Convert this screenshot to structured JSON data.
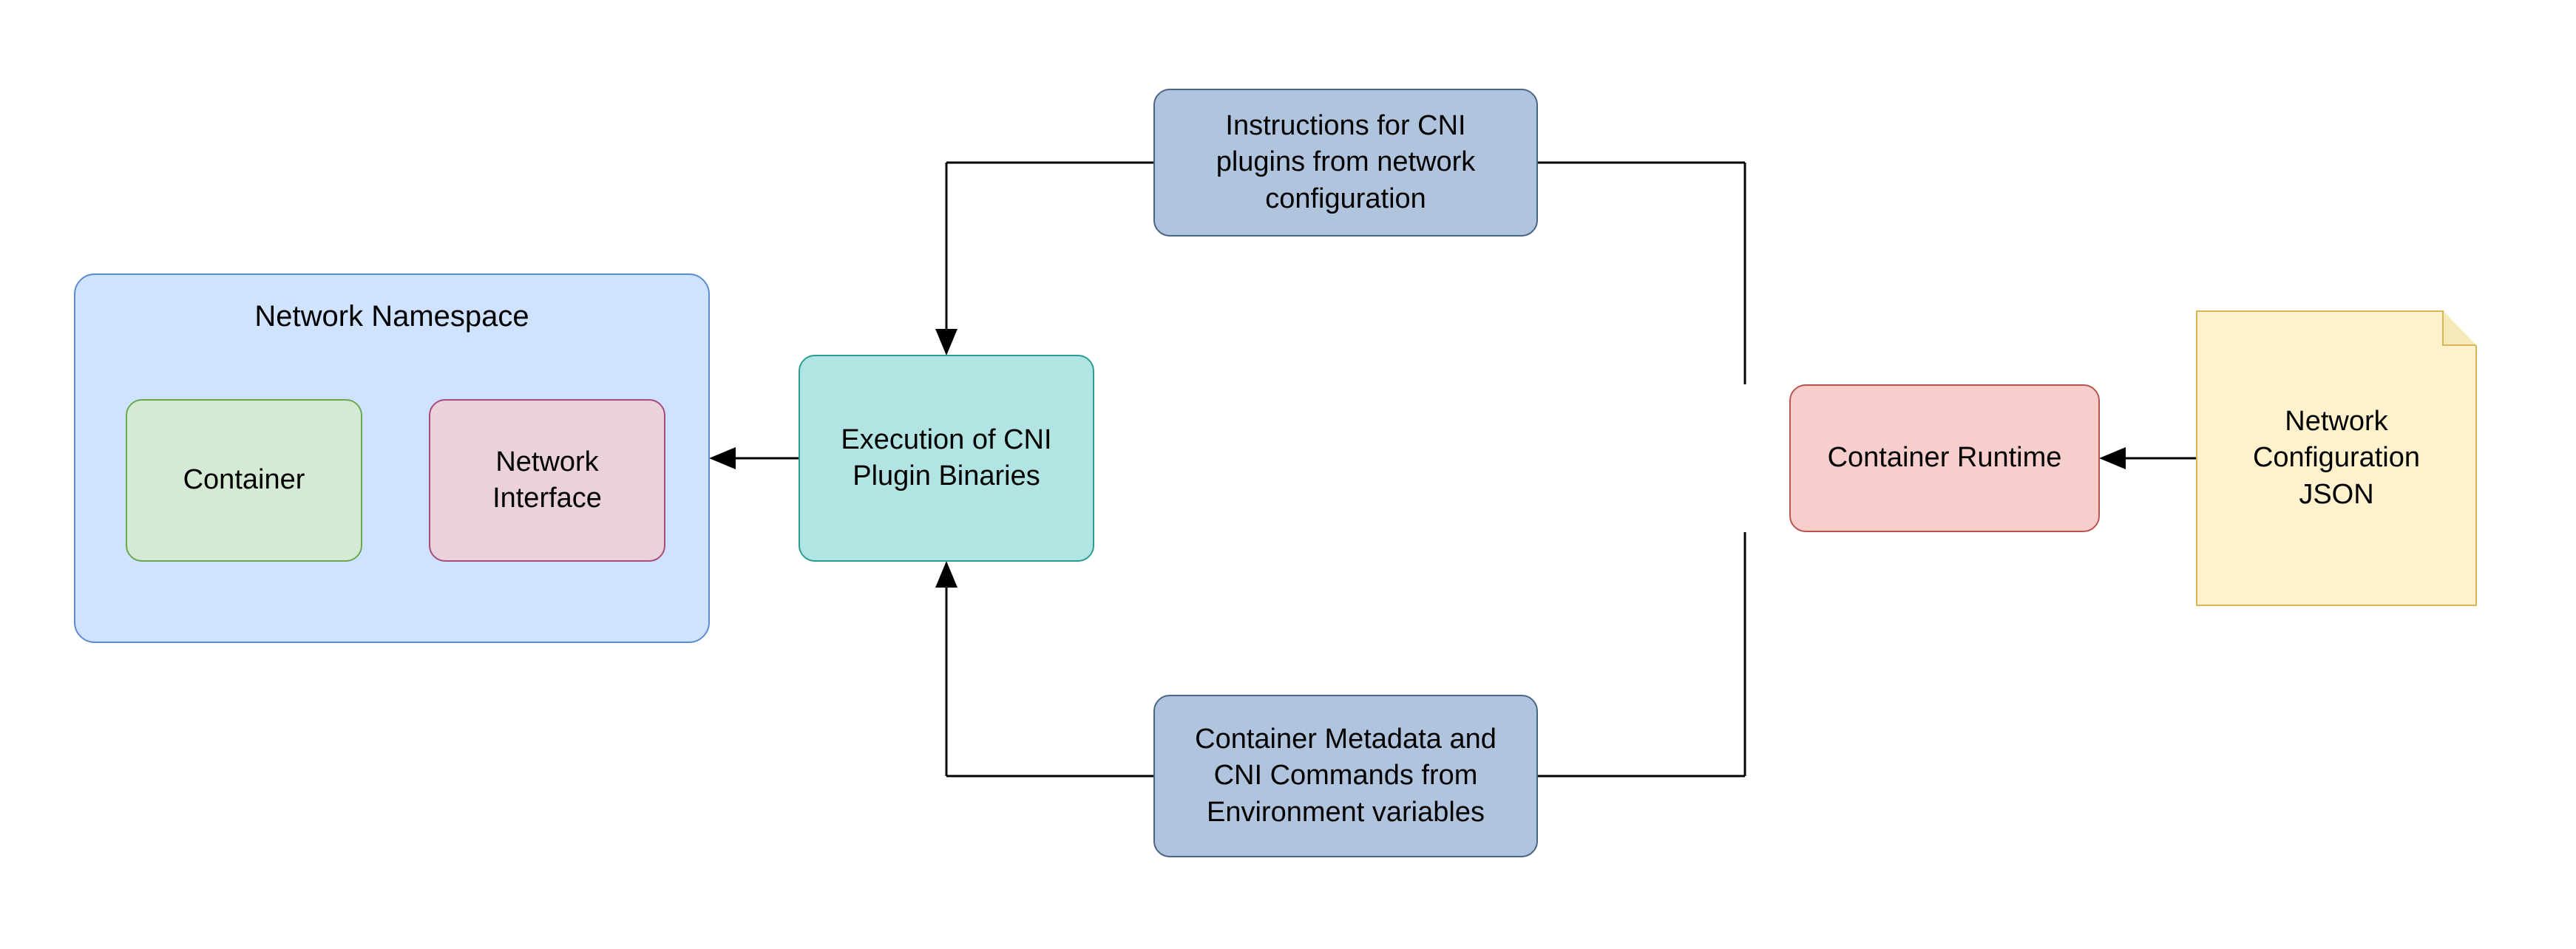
{
  "diagram": {
    "namespace": {
      "title": "Network Namespace",
      "container": "Container",
      "interface": "Network\nInterface"
    },
    "execution": "Execution of CNI\nPlugin Binaries",
    "instructions": "Instructions for CNI\nplugins from network\nconfiguration",
    "metadata": "Container Metadata and\nCNI Commands from\nEnvironment variables",
    "runtime": "Container Runtime",
    "json_note": "Network\nConfiguration\nJSON"
  },
  "colors": {
    "namespace_bg": "#cfe2ff",
    "container_bg": "#d5ead4",
    "interface_bg": "#ead1dc",
    "exec_bg": "#b1e4e3",
    "slate_bg": "#b0c4de",
    "runtime_bg": "#f8cecc",
    "note_bg": "#fff2cc"
  }
}
